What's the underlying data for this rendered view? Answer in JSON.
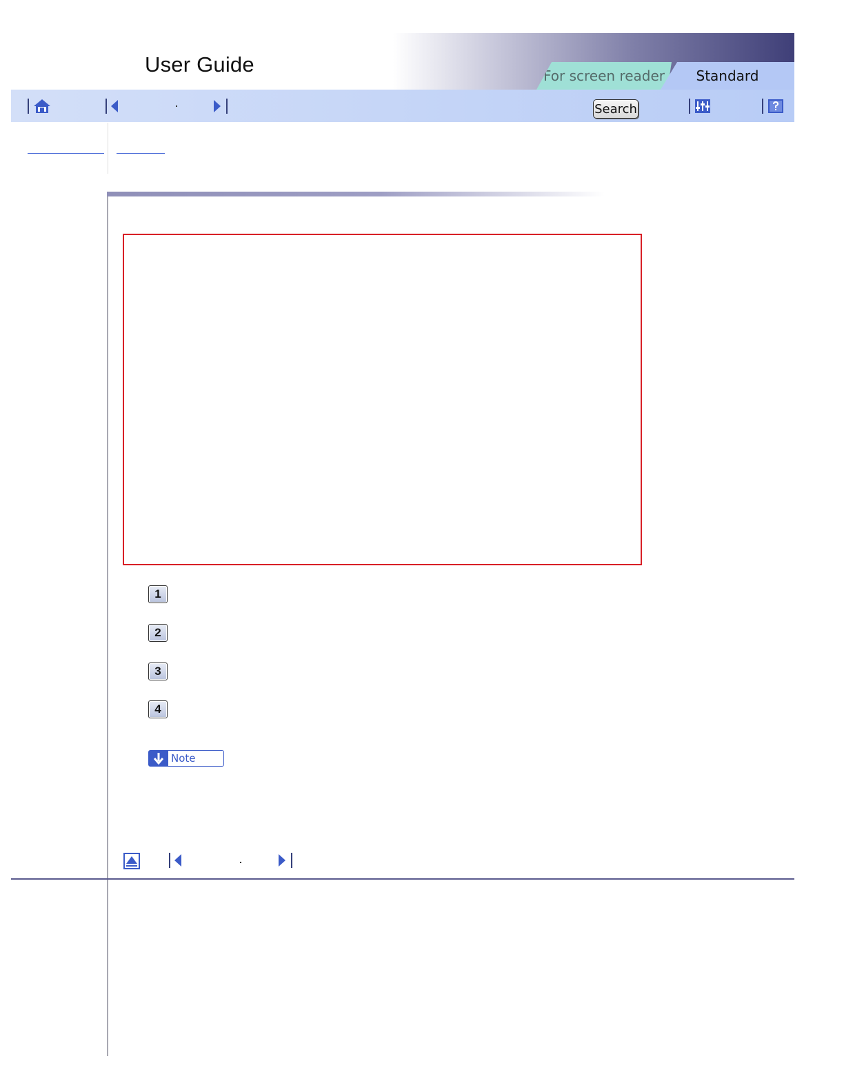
{
  "header": {
    "title": "User Guide",
    "tabs": [
      {
        "label": "For screen reader",
        "active": false
      },
      {
        "label": "Standard",
        "active": true
      }
    ]
  },
  "toolbar": {
    "search_label": "Search",
    "icons": [
      "home-icon",
      "previous-icon",
      "next-icon",
      "settings-icon",
      "help-icon"
    ]
  },
  "callouts": [
    "1",
    "2",
    "3",
    "4"
  ],
  "note": {
    "label": "Note"
  },
  "colors": {
    "toolbar": "#b8ccf6",
    "tab_reader": "#9fe0d6",
    "tab_standard": "#b4c8f5",
    "figure_border": "#d81f26",
    "note_accent": "#3b5bc8"
  }
}
